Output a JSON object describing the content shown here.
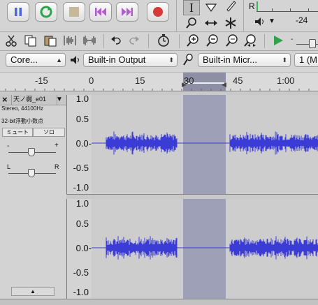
{
  "transport": {
    "buttons": [
      "pause",
      "loop",
      "stop",
      "skip-start",
      "skip-end",
      "record"
    ]
  },
  "meter": {
    "channel_label": "R",
    "db_label": "-24"
  },
  "tools": {
    "selection_cursor": "I"
  },
  "devices": {
    "host": "Core...",
    "output": "Built-in Output",
    "input": "Built-in Micr...",
    "channels": "1 (M"
  },
  "ruler": {
    "ticks": [
      "-15",
      "0",
      "15",
      "30",
      "45",
      "1:00"
    ]
  },
  "track": {
    "name": "天ノ弱_e01",
    "format": "Stereo, 44100Hz",
    "bitdepth": "32-bit浮動小数点",
    "mute_label": "ミュート",
    "solo_label": "ソロ",
    "gain_minus": "-",
    "gain_plus": "+",
    "pan_left": "L",
    "pan_right": "R"
  },
  "yaxis": {
    "labels": [
      "1.0",
      "0.5",
      "0.0-",
      "-0.5",
      "-1.0"
    ]
  },
  "colors": {
    "waveform": "#3b3bd6",
    "selection": "#9ea0b7",
    "record": "#d83a3a",
    "play": "#2fa24a"
  }
}
